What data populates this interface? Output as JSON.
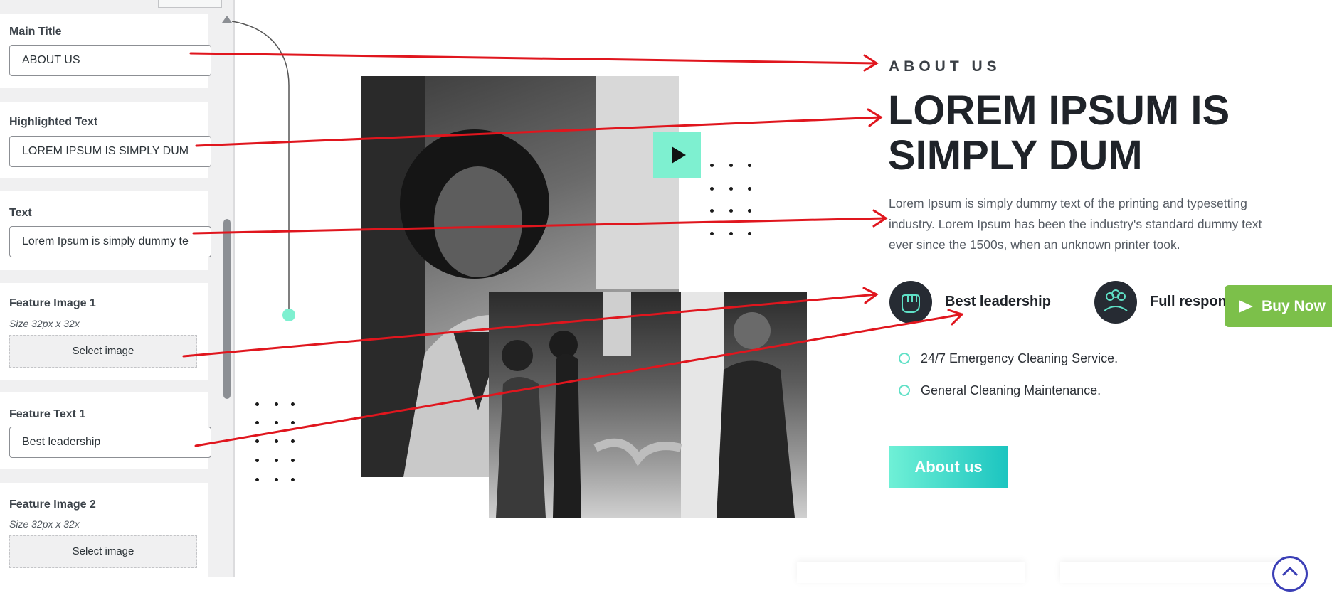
{
  "sidebar": {
    "fields": [
      {
        "label": "Main Title",
        "value": "ABOUT US"
      },
      {
        "label": "Highlighted Text",
        "value": "LOREM IPSUM IS SIMPLY DUM"
      },
      {
        "label": "Text",
        "value": "Lorem Ipsum is simply dummy te"
      },
      {
        "label": "Feature Image 1",
        "hint": "Size 32px x 32x",
        "button": "Select image"
      },
      {
        "label": "Feature Text 1",
        "value": "Best leadership"
      },
      {
        "label": "Feature Image 2",
        "hint": "Size 32px x 32x",
        "button": "Select image"
      }
    ]
  },
  "preview": {
    "eyebrow": "ABOUT US",
    "headline_line1": "LOREM IPSUM IS",
    "headline_line2": "SIMPLY DUM",
    "paragraph": "Lorem Ipsum is simply dummy text of the printing and typesetting industry. Lorem Ipsum has been the industry's standard dummy text ever since the 1500s, when an unknown printer took.",
    "features": [
      {
        "label": "Best leadership",
        "icon": "fist-icon"
      },
      {
        "label": "Full respons",
        "icon": "team-icon"
      }
    ],
    "bullets": [
      "24/7 Emergency Cleaning Service.",
      "General Cleaning Maintenance."
    ],
    "about_button": "About us",
    "buy_button": "Buy Now",
    "icons": {
      "play": "play-icon",
      "scroll_top": "scroll-top-icon",
      "send": "send-icon"
    }
  },
  "colors": {
    "accent": "#5fe0c6",
    "arrow": "#e0161e",
    "buy": "#7cc04a",
    "dark": "#1f2329"
  }
}
